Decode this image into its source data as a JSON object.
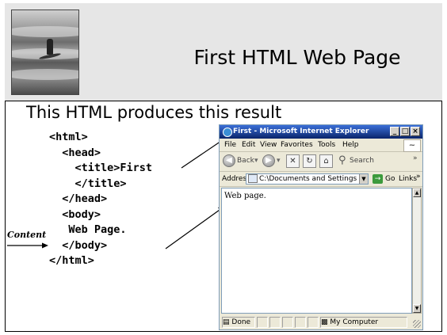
{
  "slide": {
    "title": "First HTML Web Page",
    "subtitle": "This HTML produces this result",
    "code_lines": [
      "<html>",
      "  <head>",
      "    <title>First",
      "    </title>",
      "  </head>",
      "  <body>",
      "   Web Page.",
      "  </body>",
      "</html>"
    ],
    "content_label": "Content"
  },
  "browser": {
    "title": "First - Microsoft Internet Explorer",
    "window_buttons": {
      "minimize": "_",
      "maximize": "□",
      "close": "×"
    },
    "menu": [
      "File",
      "Edit",
      "View",
      "Favorites",
      "Tools",
      "Help"
    ],
    "toolbar": {
      "back": "Back",
      "search": "Search",
      "chevron": "»"
    },
    "address": {
      "label": "Address",
      "value": "C:\\Documents and Settings",
      "go": "Go",
      "links": "Links",
      "chevron": "»"
    },
    "page_text": "Web page.",
    "status": {
      "done": "Done",
      "zone": "My Computer"
    }
  },
  "colors": {
    "title_bar": "#0a246a",
    "band": "#e6e6e6",
    "chrome": "#ece9d8"
  }
}
